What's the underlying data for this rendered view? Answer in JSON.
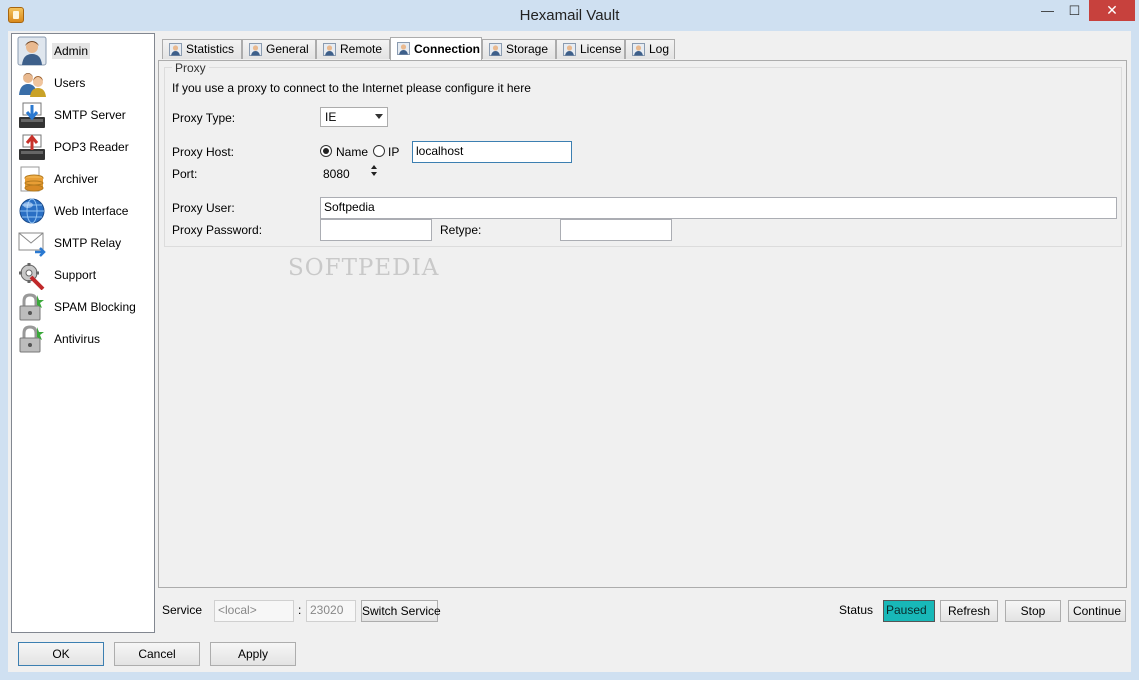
{
  "window": {
    "title": "Hexamail Vault",
    "controls": {
      "minimize": "—",
      "maximize": "☐",
      "close": "✕"
    }
  },
  "sidebar": {
    "items": [
      {
        "label": "Admin",
        "icon": "admin-user-icon",
        "selected": true
      },
      {
        "label": "Users",
        "icon": "users-icon"
      },
      {
        "label": "SMTP Server",
        "icon": "smtp-server-icon"
      },
      {
        "label": "POP3 Reader",
        "icon": "pop3-reader-icon"
      },
      {
        "label": "Archiver",
        "icon": "archiver-icon"
      },
      {
        "label": "Web Interface",
        "icon": "globe-icon"
      },
      {
        "label": "SMTP Relay",
        "icon": "envelope-relay-icon"
      },
      {
        "label": "Support",
        "icon": "support-tools-icon"
      },
      {
        "label": "SPAM Blocking",
        "icon": "lock-icon"
      },
      {
        "label": "Antivirus",
        "icon": "lock-icon"
      }
    ]
  },
  "tabs": [
    {
      "label": "Statistics"
    },
    {
      "label": "General"
    },
    {
      "label": "Remote"
    },
    {
      "label": "Connection",
      "active": true
    },
    {
      "label": "Storage"
    },
    {
      "label": "License"
    },
    {
      "label": "Log"
    }
  ],
  "proxy": {
    "group_title": "Proxy",
    "intro": "If you use a proxy to connect to the Internet please configure it here",
    "type_label": "Proxy Type:",
    "type_value": "IE",
    "host_label": "Proxy Host:",
    "host_mode_name": "Name",
    "host_mode_ip": "IP",
    "host_mode_selected": "Name",
    "host_value": "localhost",
    "port_label": "Port:",
    "port_value": "8080",
    "user_label": "Proxy User:",
    "user_value": "Softpedia",
    "password_label": "Proxy Password:",
    "password_value": "",
    "retype_label": "Retype:",
    "retype_value": ""
  },
  "watermark": "SOFTPEDIA",
  "service_bar": {
    "service_label": "Service",
    "service_host": "<local>",
    "separator": ":",
    "service_port": "23020",
    "switch_button": "Switch Service",
    "status_label": "Status",
    "status_value": "Paused",
    "status_color": "#18b8b8",
    "refresh_button": "Refresh",
    "stop_button": "Stop",
    "continue_button": "Continue"
  },
  "footer": {
    "ok": "OK",
    "cancel": "Cancel",
    "apply": "Apply"
  }
}
